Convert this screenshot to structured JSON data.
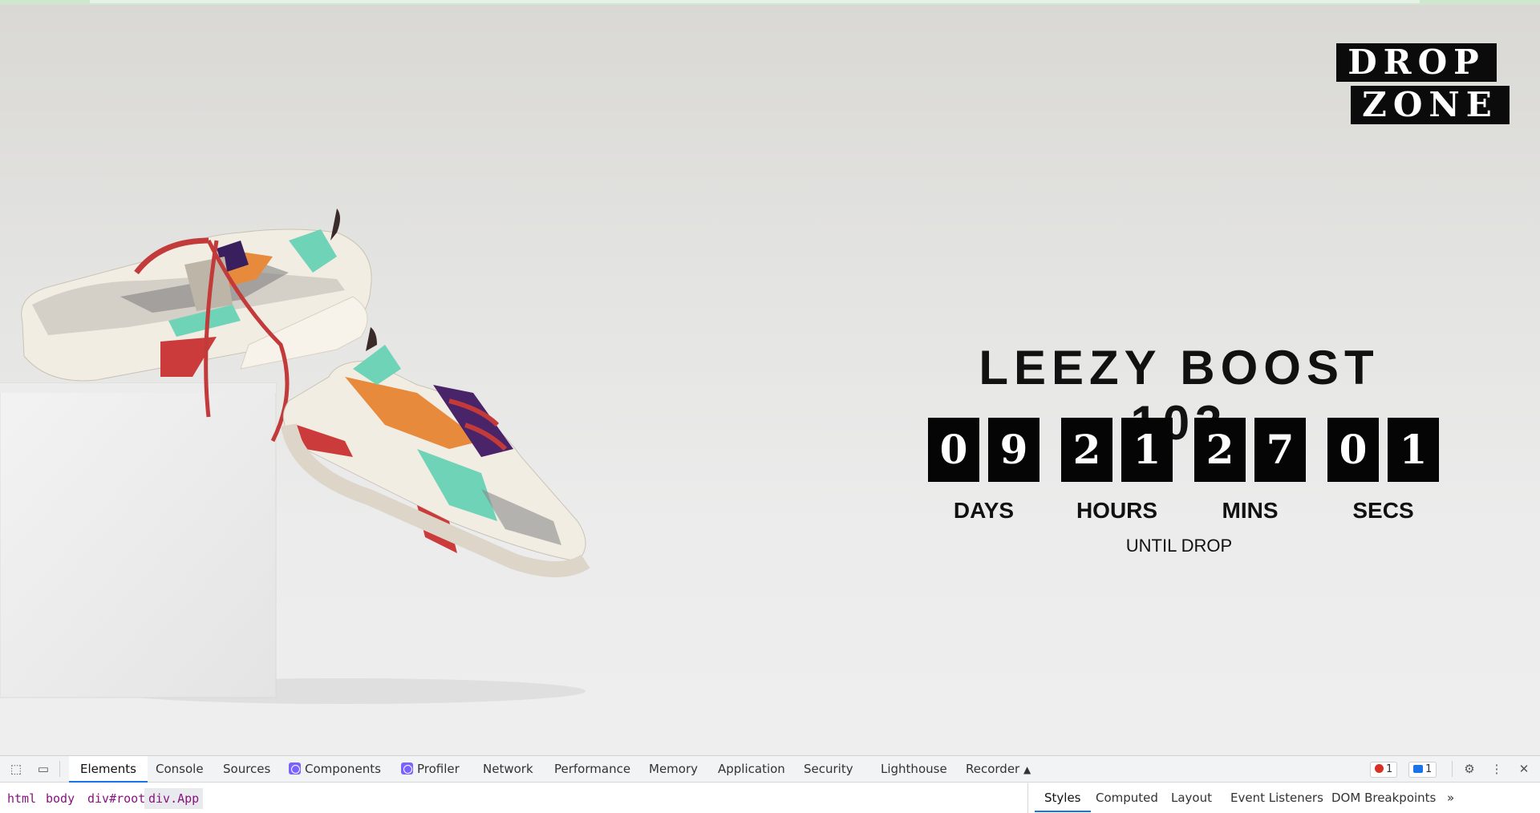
{
  "logo": {
    "line1": "DROP",
    "line2": "ZONE"
  },
  "product": {
    "title": "LEEZY BOOST 103"
  },
  "countdown": {
    "units": [
      {
        "d1": "0",
        "d2": "9",
        "label": "DAYS"
      },
      {
        "d1": "2",
        "d2": "1",
        "label": "HOURS"
      },
      {
        "d1": "2",
        "d2": "7",
        "label": "MINS"
      },
      {
        "d1": "0",
        "d2": "1",
        "label": "SECS"
      }
    ],
    "caption": "UNTIL DROP"
  },
  "devtools": {
    "tabs": [
      "Elements",
      "Console",
      "Sources",
      "Components",
      "Profiler",
      "Network",
      "Performance",
      "Memory",
      "Application",
      "Security",
      "Lighthouse",
      "Recorder"
    ],
    "error_count": "1",
    "message_count": "1",
    "breadcrumbs": [
      "html",
      "body",
      "div#root",
      "div.App"
    ],
    "side_tabs": [
      "Styles",
      "Computed",
      "Layout",
      "Event Listeners",
      "DOM Breakpoints"
    ],
    "icons": [
      "inspect-icon",
      "device-toggle-icon",
      "flask-icon",
      "gear-icon",
      "kebab-menu-icon",
      "close-icon",
      "chevron-double-right-icon"
    ]
  },
  "colors": {
    "accent": "#1a73e8",
    "brand_black": "#050505",
    "background": "#e6e6e4"
  }
}
